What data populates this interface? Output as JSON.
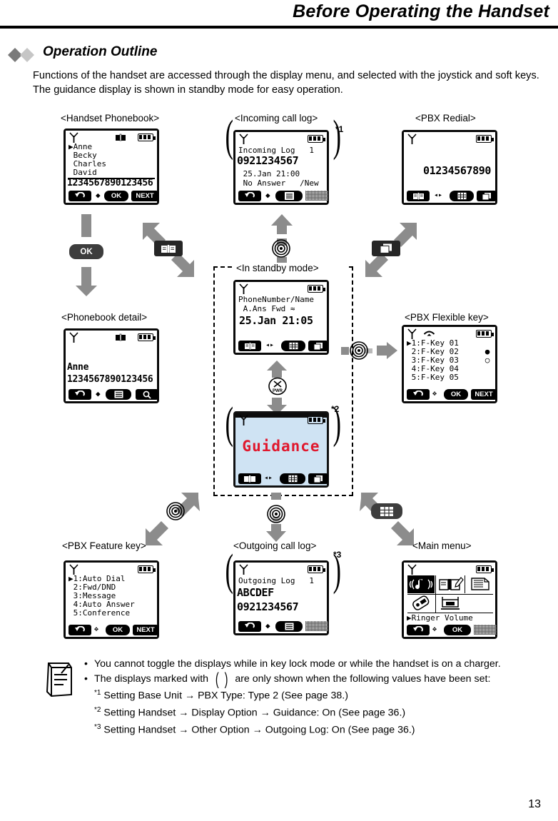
{
  "header": {
    "title": "Before Operating the Handset"
  },
  "section": {
    "title": "Operation Outline",
    "intro": "Functions of the handset are accessed through the display menu, and selected with the joystick and soft keys. The guidance display is shown in standby mode for easy operation."
  },
  "captions": {
    "handset_phonebook": "<Handset Phonebook>",
    "incoming_call_log": "<Incoming call log>",
    "pbx_redial": "<PBX Redial>",
    "phonebook_detail": "<Phonebook detail>",
    "in_standby_mode": "<In standby mode>",
    "pbx_flexible_key": "<PBX Flexible key>",
    "pbx_feature_key": "<PBX Feature key>",
    "outgoing_call_log": "<Outgoing call log>",
    "main_menu": "<Main menu>"
  },
  "asterisks": {
    "a1": "*1",
    "a2": "*2",
    "a3": "*3"
  },
  "screens": {
    "handset_phonebook": {
      "lines": [
        "▶Anne",
        " Becky",
        " Charles",
        " David"
      ],
      "number": "1234567890123456",
      "softkeys": {
        "left": "redial-icon",
        "mid_nav": "up-down",
        "ok": "OK",
        "right": "NEXT"
      }
    },
    "incoming_call_log": {
      "title": "Incoming Log   1",
      "number": "0921234567",
      "datetime": " 25.Jan 21:00",
      "status": " No Answer   /New",
      "softkeys": {
        "left": "redial-icon",
        "mid_nav": "up-down",
        "center": "menu-icon",
        "right": "hatch"
      }
    },
    "pbx_redial": {
      "number": "01234567890",
      "softkeys": {
        "left": "phonebook-icon",
        "nav": "left-right",
        "center": "keypad-icon",
        "right": "page-icon"
      }
    },
    "phonebook_detail": {
      "name": "Anne",
      "number": "1234567890123456",
      "softkeys": {
        "left": "redial-icon",
        "mid_nav": "up-down",
        "center": "menu-icon",
        "right": "search-icon"
      }
    },
    "in_standby_mode": {
      "line1": "PhoneNumber/Name",
      "line2": " A.Ans Fwd ≈",
      "clock": "25.Jan 21:05",
      "softkeys": {
        "left": "phonebook-icon",
        "nav": "left-right",
        "center": "keypad-icon",
        "right": "page-icon"
      }
    },
    "guidance": {
      "text": "Guidance",
      "bg_color": "#cfe3f3",
      "text_color": "#e0182d",
      "softkeys": {
        "left": "book-icon",
        "nav": "left-right",
        "center": "keypad-icon",
        "right": "page-icon"
      }
    },
    "pbx_flexible_key": {
      "lines": [
        "▶1:F-Key 01",
        " 2:F-Key 02",
        " 3:F-Key 03",
        " 4:F-Key 04",
        " 5:F-Key 05"
      ],
      "markers": [
        "●",
        "○"
      ],
      "softkeys": {
        "left": "redial-icon",
        "mid_nav": "4way",
        "ok": "OK",
        "right": "NEXT"
      }
    },
    "pbx_feature_key": {
      "lines": [
        "▶1:Auto Dial",
        " 2:Fwd/DND",
        " 3:Message",
        " 4:Auto Answer",
        " 5:Conference"
      ],
      "softkeys": {
        "left": "redial-icon",
        "mid_nav": "4way",
        "ok": "OK",
        "right": "NEXT"
      }
    },
    "outgoing_call_log": {
      "title": "Outgoing Log   1",
      "name": "ABCDEF",
      "number": "0921234567",
      "softkeys": {
        "left": "redial-icon",
        "mid_nav": "up-down",
        "center": "menu-icon",
        "right": "hatch"
      }
    },
    "main_menu": {
      "icons": [
        "ringer-icon",
        "phonebook-edit-icon",
        "folder-icon",
        "handset-icon",
        "base-unit-icon"
      ],
      "label": "▶Ringer Volume",
      "softkeys": {
        "left": "redial-icon",
        "mid_nav": "4way",
        "ok": "OK",
        "right": "hatch"
      }
    }
  },
  "transitions": {
    "ok_key": "OK",
    "phonebook_key": "phonebook-icon",
    "joystick_key": "joystick-icon",
    "page_key": "page-icon",
    "keypad_key": "keypad-icon",
    "power_key": "PWR"
  },
  "notes": {
    "bullet1": "You cannot toggle the displays while in key lock mode or while the handset is on a charger.",
    "bullet2_a": "The displays marked with",
    "bullet2_b": "are only shown when the following values have been set:",
    "star1": "Setting Base Unit → PBX Type: Type 2 (See page 38.)",
    "star2": "Setting Handset → Display Option → Guidance: On (See page 36.)",
    "star3": "Setting Handset → Other Option → Outgoing Log: On (See page 36.)",
    "star1_mark": "*1",
    "star2_mark": "*2",
    "star3_mark": "*3"
  },
  "page_number": "13"
}
